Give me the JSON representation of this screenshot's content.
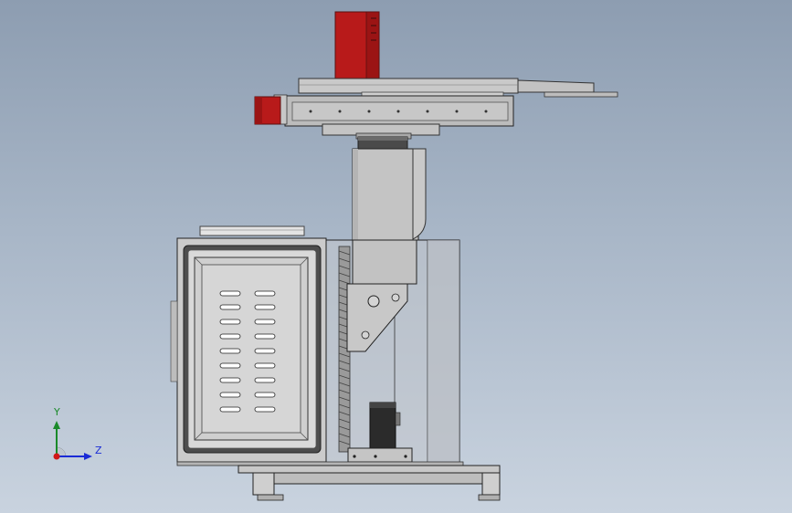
{
  "viewport": {
    "background_top": "#8d9db1",
    "background_bottom": "#c9d3df"
  },
  "triad": {
    "axis_y_label": "Y",
    "axis_z_label": "Z",
    "color_y": "#1a8a2a",
    "color_z": "#1a2bd6",
    "color_x": "#d01818"
  },
  "model": {
    "motor_color": "#b81a1a",
    "body_color": "#bfbfbf",
    "panel_color": "#c8c8c8",
    "dark_color": "#5a5a5a",
    "window_slot_count": 18
  }
}
